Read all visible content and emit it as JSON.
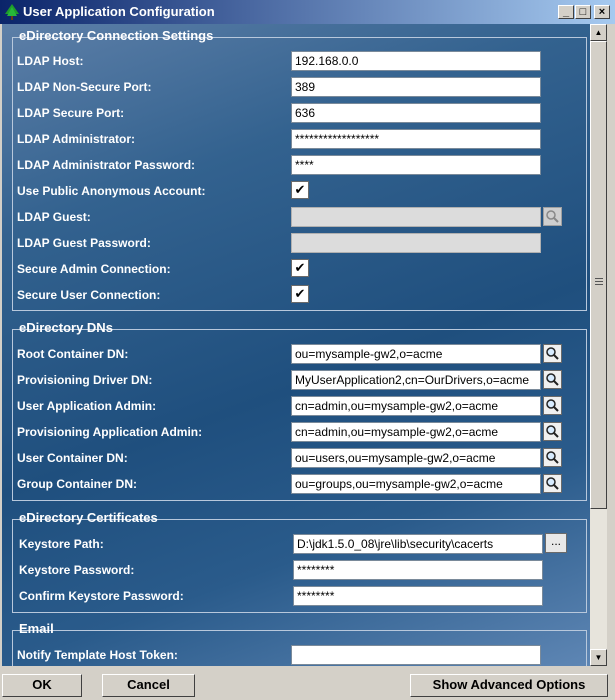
{
  "window": {
    "title": "User Application Configuration",
    "min_label": "_",
    "max_label": "□",
    "close_label": "×"
  },
  "sections": {
    "connection": {
      "title": "eDirectory Connection Settings",
      "ldap_host": {
        "label": "LDAP Host:",
        "value": "192.168.0.0"
      },
      "non_secure_port": {
        "label": "LDAP Non-Secure Port:",
        "value": "389"
      },
      "secure_port": {
        "label": "LDAP Secure Port:",
        "value": "636"
      },
      "admin": {
        "label": "LDAP Administrator:",
        "value": "******************"
      },
      "admin_password": {
        "label": "LDAP Administrator Password:",
        "value": "****"
      },
      "public_anonymous": {
        "label": "Use Public Anonymous Account:",
        "checked": true,
        "mark": "✔"
      },
      "guest": {
        "label": "LDAP Guest:",
        "value": ""
      },
      "guest_password": {
        "label": "LDAP Guest Password:",
        "value": ""
      },
      "secure_admin": {
        "label": "Secure Admin Connection:",
        "checked": true,
        "mark": "✔"
      },
      "secure_user": {
        "label": "Secure User Connection:",
        "checked": true,
        "mark": "✔"
      }
    },
    "dns": {
      "title": "eDirectory DNs",
      "root_container": {
        "label": "Root Container DN:",
        "value": "ou=mysample-gw2,o=acme"
      },
      "provisioning_driver": {
        "label": "Provisioning Driver DN:",
        "value": "MyUserApplication2,cn=OurDrivers,o=acme"
      },
      "user_app_admin": {
        "label": "User Application Admin:",
        "value": "cn=admin,ou=mysample-gw2,o=acme"
      },
      "prov_app_admin": {
        "label": "Provisioning Application Admin:",
        "value": "cn=admin,ou=mysample-gw2,o=acme"
      },
      "user_container": {
        "label": "User Container DN:",
        "value": "ou=users,ou=mysample-gw2,o=acme"
      },
      "group_container": {
        "label": "Group Container DN:",
        "value": "ou=groups,ou=mysample-gw2,o=acme"
      }
    },
    "certificates": {
      "title": "eDirectory Certificates",
      "keystore_path": {
        "label": "Keystore Path:",
        "value": "D:\\jdk1.5.0_08\\jre\\lib\\security\\cacerts",
        "browse": "..."
      },
      "keystore_password": {
        "label": "Keystore Password:",
        "value": "********"
      },
      "confirm_password": {
        "label": "Confirm Keystore Password:",
        "value": "********"
      }
    },
    "email": {
      "title": "Email",
      "notify_host": {
        "label": "Notify Template Host Token:",
        "value": ""
      }
    }
  },
  "scrollbar": {
    "up": "▲",
    "down": "▼"
  },
  "buttons": {
    "ok": "OK",
    "cancel": "Cancel",
    "advanced": "Show Advanced Options"
  },
  "colors": {
    "titlebar_start": "#0a246a",
    "titlebar_end": "#a6caf0",
    "panel_blue": "#1f4f7e"
  }
}
